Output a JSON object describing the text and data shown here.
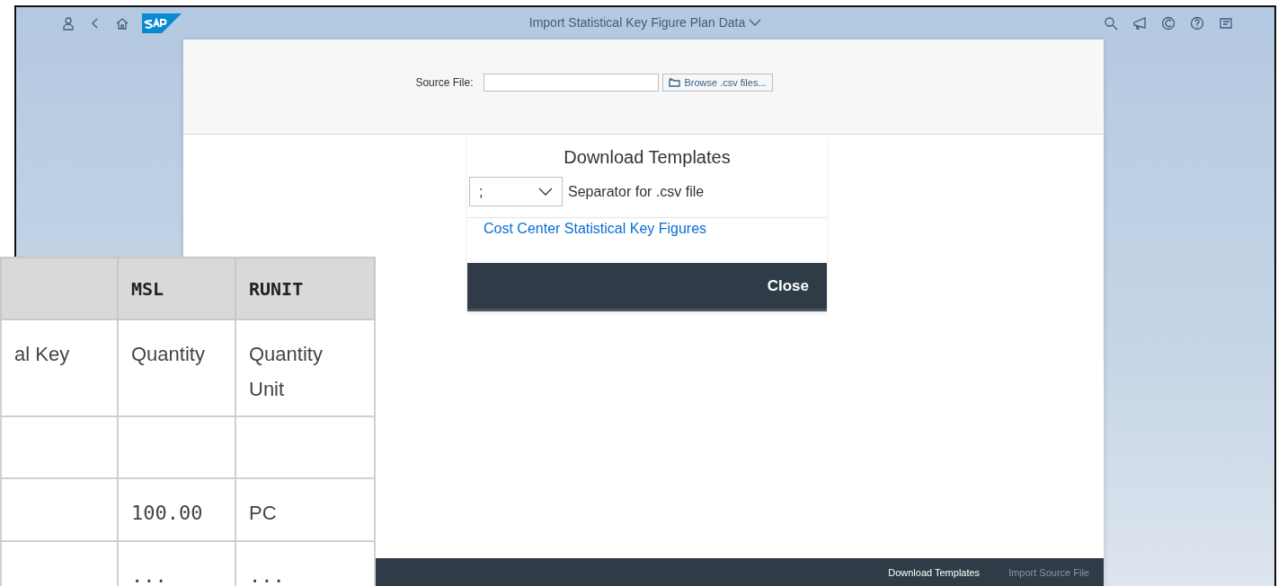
{
  "shell": {
    "title": "Import Statistical Key Figure Plan Data"
  },
  "source_file": {
    "label": "Source File:",
    "browse_button": "Browse .csv files..."
  },
  "dialog": {
    "title": "Download Templates",
    "separator": {
      "value": ";",
      "label": "Separator for .csv file"
    },
    "links": [
      "Cost Center Statistical Key Figures"
    ],
    "close_button": "Close"
  },
  "footer": {
    "buttons": [
      {
        "label": "Download Templates",
        "disabled": false
      },
      {
        "label": "Import Source File",
        "disabled": true
      }
    ]
  },
  "table": {
    "columns": [
      {
        "kind": "text"
      },
      {
        "label": "MSL",
        "kind": "code"
      },
      {
        "label": "RUNIT",
        "kind": "code"
      }
    ],
    "rows": [
      [
        {
          "text": "al Key",
          "kind": "text"
        },
        {
          "text": "Quantity",
          "kind": "text"
        },
        {
          "text": "Quantity Unit",
          "kind": "text"
        }
      ],
      [
        {
          "kind": "text"
        },
        {
          "kind": "text"
        },
        {
          "kind": "text"
        }
      ],
      [
        {
          "kind": "text"
        },
        {
          "text": "100.00",
          "kind": "code"
        },
        {
          "text": "PC",
          "kind": "text"
        }
      ],
      [
        {
          "kind": "text"
        },
        {
          "text": "...",
          "kind": "code"
        },
        {
          "text": "...",
          "kind": "code"
        }
      ]
    ]
  }
}
